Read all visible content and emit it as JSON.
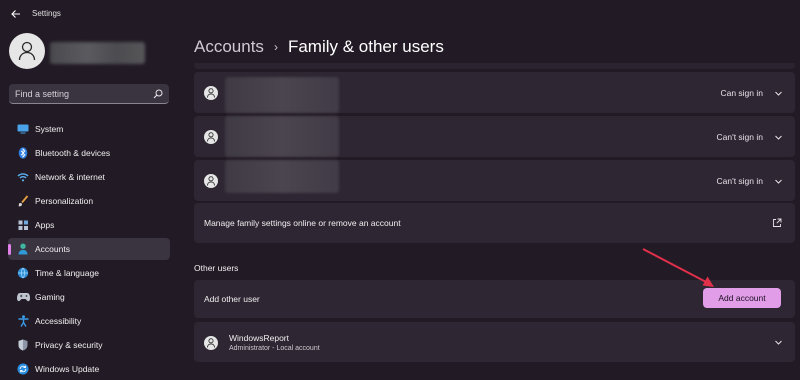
{
  "window": {
    "title": "Settings"
  },
  "sidebar": {
    "search": {
      "placeholder": "Find a setting"
    },
    "items": [
      {
        "label": "System",
        "icon": "monitor-icon",
        "active": false
      },
      {
        "label": "Bluetooth & devices",
        "icon": "bluetooth-icon",
        "active": false
      },
      {
        "label": "Network & internet",
        "icon": "wifi-icon",
        "active": false
      },
      {
        "label": "Personalization",
        "icon": "brush-icon",
        "active": false
      },
      {
        "label": "Apps",
        "icon": "apps-icon",
        "active": false
      },
      {
        "label": "Accounts",
        "icon": "person-icon",
        "active": true
      },
      {
        "label": "Time & language",
        "icon": "globe-clock-icon",
        "active": false
      },
      {
        "label": "Gaming",
        "icon": "gamepad-icon",
        "active": false
      },
      {
        "label": "Accessibility",
        "icon": "accessibility-icon",
        "active": false
      },
      {
        "label": "Privacy & security",
        "icon": "shield-icon",
        "active": false
      },
      {
        "label": "Windows Update",
        "icon": "sync-icon",
        "active": false
      }
    ]
  },
  "breadcrumb": {
    "parent": "Accounts",
    "separator": "›",
    "current": "Family & other users"
  },
  "family_users": [
    {
      "status": "Can sign in"
    },
    {
      "status": "Can't sign in"
    },
    {
      "status": "Can't sign in"
    }
  ],
  "manage_family": {
    "label": "Manage family settings online or remove an account"
  },
  "other_users": {
    "title": "Other users",
    "add_label": "Add other user",
    "add_button": "Add account",
    "accounts": [
      {
        "name": "WindowsReport",
        "subtitle": "Administrator - Local account"
      }
    ]
  },
  "colors": {
    "accent": "#e19de8",
    "background": "#221a25",
    "card": "#2e2632",
    "annotation_arrow": "#e0304a"
  }
}
